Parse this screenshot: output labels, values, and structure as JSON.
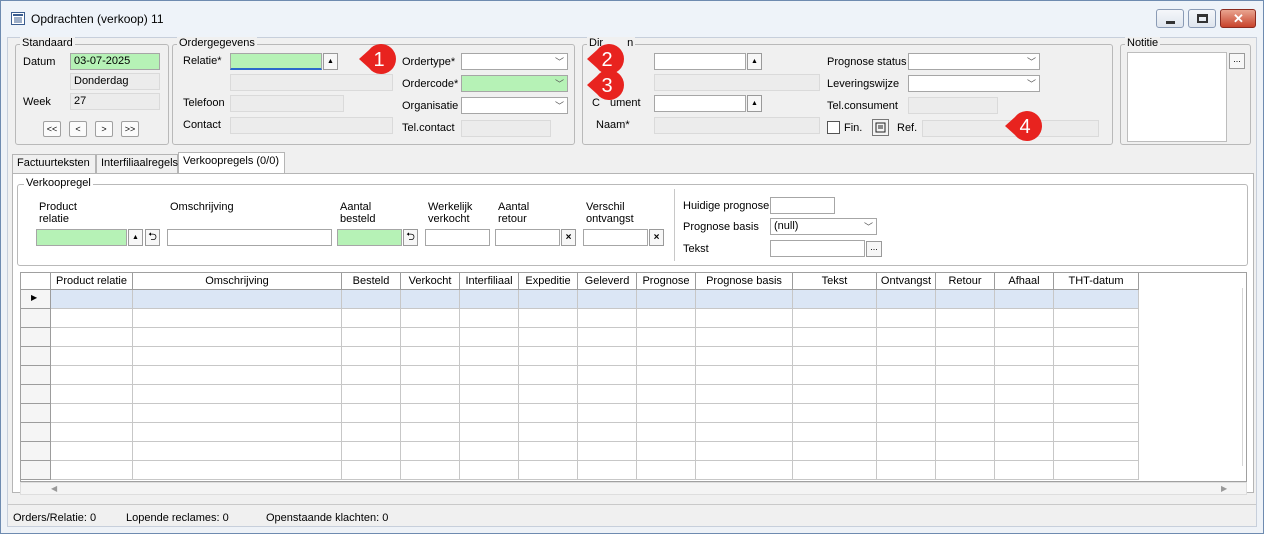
{
  "window": {
    "title": "Opdrachten (verkoop) 11"
  },
  "standaard": {
    "legend": "Standaard",
    "datum_label": "Datum",
    "datum_value": "03-07-2025",
    "day_value": "Donderdag",
    "week_label": "Week",
    "week_value": "27",
    "nav": [
      "<<",
      "<",
      ">",
      ">>"
    ]
  },
  "ordergegevens": {
    "legend": "Ordergegevens",
    "relatie_label": "Relatie*",
    "telefoon_label": "Telefoon",
    "contact_label": "Contact",
    "ordertype_label": "Ordertype*",
    "ordercode_label": "Ordercode*",
    "organisatie_label": "Organisatie",
    "telcontact_label": "Tel.contact"
  },
  "direct": {
    "legend": "Dir",
    "legend_tail": "n",
    "consument_label": "C",
    "consument_tail": "ument",
    "naam_label": "Naam*",
    "prognose_status_label": "Prognose status",
    "leveringswijze_label": "Leveringswijze",
    "tel_consument_label": "Tel.consument",
    "fin_label": "Fin.",
    "ref_label": "Ref."
  },
  "notitie": {
    "legend": "Notitie",
    "dots": "..."
  },
  "tabs": [
    "Factuurteksten",
    "Interfiliaalregels",
    "Verkoopregels (0/0)"
  ],
  "verkoopregel": {
    "legend": "Verkoopregel",
    "product_relatie": "Product\nrelatie",
    "omschrijving": "Omschrijving",
    "aantal_besteld": "Aantal\nbesteld",
    "werkelijk_verkocht": "Werkelijk\nverkocht",
    "aantal_retour": "Aantal\nretour",
    "verschil_ontvangst": "Verschil\nontvangst",
    "huidige_prognose": "Huidige prognose",
    "prognose_basis": "Prognose basis",
    "prognose_basis_value": "(null)",
    "tekst": "Tekst",
    "dots": "..."
  },
  "grid": {
    "columns": [
      "Product relatie",
      "Omschrijving",
      "Besteld",
      "Verkocht",
      "Interfiliaal",
      "Expeditie",
      "Geleverd",
      "Prognose",
      "Prognose basis",
      "Tekst",
      "Ontvangst",
      "Retour",
      "Afhaal",
      "THT-datum"
    ]
  },
  "status": {
    "orders": "Orders/Relatie: 0",
    "reclames": "Lopende reclames: 0",
    "klachten": "Openstaande klachten: 0"
  },
  "callouts": [
    "1",
    "2",
    "3",
    "4"
  ],
  "colors": {
    "required_field": "#b6f2b6",
    "callout": "#e8231f",
    "selected_row": "#dbe6f5"
  }
}
